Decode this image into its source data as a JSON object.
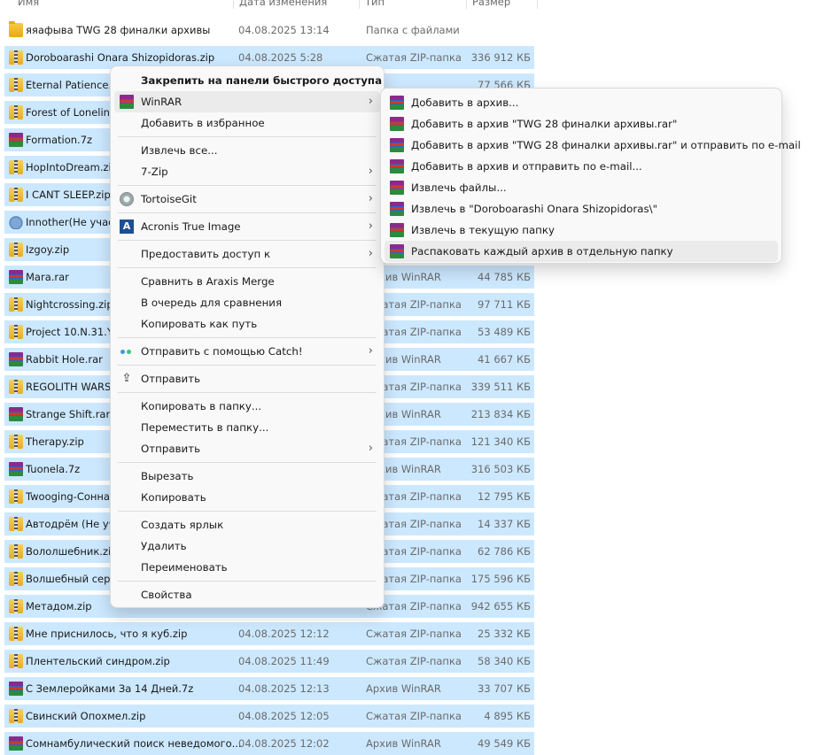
{
  "columns": {
    "name": "Имя",
    "date": "Дата изменения",
    "type": "Тип",
    "size": "Размер"
  },
  "files": [
    {
      "name": "яяафыва TWG 28 финалки архивы",
      "date": "04.08.2025 13:14",
      "type": "Папка с файлами",
      "size": "",
      "icon": "folder",
      "selected": false
    },
    {
      "name": "Doroboarashi Onara Shizopidoras.zip",
      "date": "04.08.2025 5:28",
      "type": "Сжатая ZIP-папка",
      "size": "336 912 КБ",
      "icon": "zip",
      "selected": true
    },
    {
      "name": "Eternal Patience.zi",
      "date": "",
      "type": "",
      "size": "77 566 КБ",
      "icon": "zip",
      "selected": true
    },
    {
      "name": "Forest of Loneline",
      "date": "",
      "type": "",
      "size": "",
      "icon": "zip",
      "selected": true
    },
    {
      "name": "Formation.7z",
      "date": "",
      "type": "",
      "size": "",
      "icon": "rar",
      "selected": true
    },
    {
      "name": "HopIntoDream.zip",
      "date": "",
      "type": "",
      "size": "",
      "icon": "zip",
      "selected": true
    },
    {
      "name": "I CANT SLEEP.zip",
      "date": "",
      "type": "",
      "size": "",
      "icon": "zip",
      "selected": true
    },
    {
      "name": "Innother(Не участ",
      "date": "",
      "type": "",
      "size": "",
      "icon": "sheep",
      "selected": true
    },
    {
      "name": "Izgoy.zip",
      "date": "",
      "type": "",
      "size": "",
      "icon": "zip",
      "selected": true
    },
    {
      "name": "Mara.rar",
      "date": "",
      "type": "Архив WinRAR",
      "size": "44 785 КБ",
      "icon": "rar",
      "selected": true
    },
    {
      "name": "Nightcrossing.zip",
      "date": "",
      "type": "Сжатая ZIP-папка",
      "size": "97 711 КБ",
      "icon": "zip",
      "selected": true
    },
    {
      "name": "Project 10.N.31.Y.z",
      "date": "",
      "type": "Сжатая ZIP-папка",
      "size": "53 489 КБ",
      "icon": "zip",
      "selected": true
    },
    {
      "name": "Rabbit Hole.rar",
      "date": "",
      "type": "Архив WinRAR",
      "size": "41 667 КБ",
      "icon": "rar",
      "selected": true
    },
    {
      "name": "REGOLITH WARS.z",
      "date": "",
      "type": "Сжатая ZIP-папка",
      "size": "339 511 КБ",
      "icon": "zip",
      "selected": true
    },
    {
      "name": "Strange Shift.rar",
      "date": "",
      "type": "Архив WinRAR",
      "size": "213 834 КБ",
      "icon": "rar",
      "selected": true
    },
    {
      "name": "Therapy.zip",
      "date": "",
      "type": "Сжатая ZIP-папка",
      "size": "121 340 КБ",
      "icon": "zip",
      "selected": true
    },
    {
      "name": "Tuonela.7z",
      "date": "",
      "type": "Архив WinRAR",
      "size": "316 503 КБ",
      "icon": "rar",
      "selected": true
    },
    {
      "name": "Twooging-Сонная",
      "date": "",
      "type": "Сжатая ZIP-папка",
      "size": "12 795 КБ",
      "icon": "zip",
      "selected": true
    },
    {
      "name": "Автодрём (Не уча",
      "date": "",
      "type": "Сжатая ZIP-папка",
      "size": "14 337 КБ",
      "icon": "zip",
      "selected": true
    },
    {
      "name": "Вололшебник.zip",
      "date": "",
      "type": "Сжатая ZIP-папка",
      "size": "62 786 КБ",
      "icon": "zip",
      "selected": true
    },
    {
      "name": "Волшебный серв",
      "date": "",
      "type": "Сжатая ZIP-папка",
      "size": "175 596 КБ",
      "icon": "zip",
      "selected": true
    },
    {
      "name": "Метадом.zip",
      "date": "",
      "type": "Сжатая ZIP-папка",
      "size": "942 655 КБ",
      "icon": "zip",
      "selected": true
    },
    {
      "name": "Мне приснилось, что я куб.zip",
      "date": "04.08.2025 12:12",
      "type": "Сжатая ZIP-папка",
      "size": "25 332 КБ",
      "icon": "zip",
      "selected": true
    },
    {
      "name": "Плентельский синдром.zip",
      "date": "04.08.2025 11:49",
      "type": "Сжатая ZIP-папка",
      "size": "58 340 КБ",
      "icon": "zip",
      "selected": true
    },
    {
      "name": "С Землеройками За 14 Дней.7z",
      "date": "04.08.2025 12:13",
      "type": "Архив WinRAR",
      "size": "33 707 КБ",
      "icon": "rar",
      "selected": true
    },
    {
      "name": "Свинский Опохмел.zip",
      "date": "04.08.2025 12:05",
      "type": "Сжатая ZIP-папка",
      "size": "4 895 КБ",
      "icon": "zip",
      "selected": true
    },
    {
      "name": "Сомнамбулический поиск неведомого...",
      "date": "04.08.2025 12:02",
      "type": "Архив WinRAR",
      "size": "49 549 КБ",
      "icon": "rar",
      "selected": true
    }
  ],
  "context_menu": [
    {
      "label": "Закрепить на панели быстрого доступа",
      "bold": true,
      "icon": "",
      "submenu": false
    },
    {
      "label": "WinRAR",
      "icon": "winrar-icon",
      "submenu": true,
      "highlighted": true
    },
    {
      "label": "Добавить в избранное",
      "icon": "",
      "submenu": false
    },
    {
      "sep": true
    },
    {
      "label": "Извлечь все...",
      "icon": "",
      "submenu": false
    },
    {
      "label": "7-Zip",
      "icon": "",
      "submenu": true
    },
    {
      "sep": true
    },
    {
      "label": "TortoiseGit",
      "icon": "tortoisegit-icon",
      "submenu": true
    },
    {
      "sep": true
    },
    {
      "label": "Acronis True Image",
      "icon": "acronis-icon",
      "submenu": true
    },
    {
      "sep": true
    },
    {
      "label": "Предоставить доступ к",
      "icon": "",
      "submenu": true
    },
    {
      "sep": true
    },
    {
      "label": "Сравнить в Araxis Merge",
      "icon": "",
      "submenu": false
    },
    {
      "label": "В очередь для сравнения",
      "icon": "",
      "submenu": false
    },
    {
      "label": "Копировать как путь",
      "icon": "",
      "submenu": false
    },
    {
      "sep": true
    },
    {
      "label": "Отправить с помощью Catch!",
      "icon": "catch-icon",
      "submenu": true
    },
    {
      "sep": true
    },
    {
      "label": "Отправить",
      "icon": "share-icon",
      "submenu": false
    },
    {
      "sep": true
    },
    {
      "label": "Копировать в папку...",
      "icon": "",
      "submenu": false
    },
    {
      "label": "Переместить в папку...",
      "icon": "",
      "submenu": false
    },
    {
      "label": "Отправить",
      "icon": "",
      "submenu": true
    },
    {
      "sep": true
    },
    {
      "label": "Вырезать",
      "icon": "",
      "submenu": false
    },
    {
      "label": "Копировать",
      "icon": "",
      "submenu": false
    },
    {
      "sep": true
    },
    {
      "label": "Создать ярлык",
      "icon": "",
      "submenu": false
    },
    {
      "label": "Удалить",
      "icon": "",
      "submenu": false
    },
    {
      "label": "Переименовать",
      "icon": "",
      "submenu": false
    },
    {
      "sep": true
    },
    {
      "label": "Свойства",
      "icon": "",
      "submenu": false
    }
  ],
  "winrar_submenu": [
    {
      "label": "Добавить в архив...",
      "icon": "winrar-icon"
    },
    {
      "label": "Добавить в архив \"TWG 28 финалки архивы.rar\"",
      "icon": "winrar-icon"
    },
    {
      "label": "Добавить в архив \"TWG 28 финалки архивы.rar\" и отправить по e-mail",
      "icon": "winrar-icon"
    },
    {
      "label": "Добавить в архив и отправить по e-mail...",
      "icon": "winrar-icon"
    },
    {
      "label": "Извлечь файлы...",
      "icon": "winrar-icon"
    },
    {
      "label": "Извлечь в \"Doroboarashi Onara Shizopidoras\\\"",
      "icon": "winrar-icon"
    },
    {
      "label": "Извлечь в текущую папку",
      "icon": "winrar-icon"
    },
    {
      "label": "Распаковать каждый архив в отдельную папку",
      "icon": "winrar-icon",
      "highlighted": true
    }
  ]
}
